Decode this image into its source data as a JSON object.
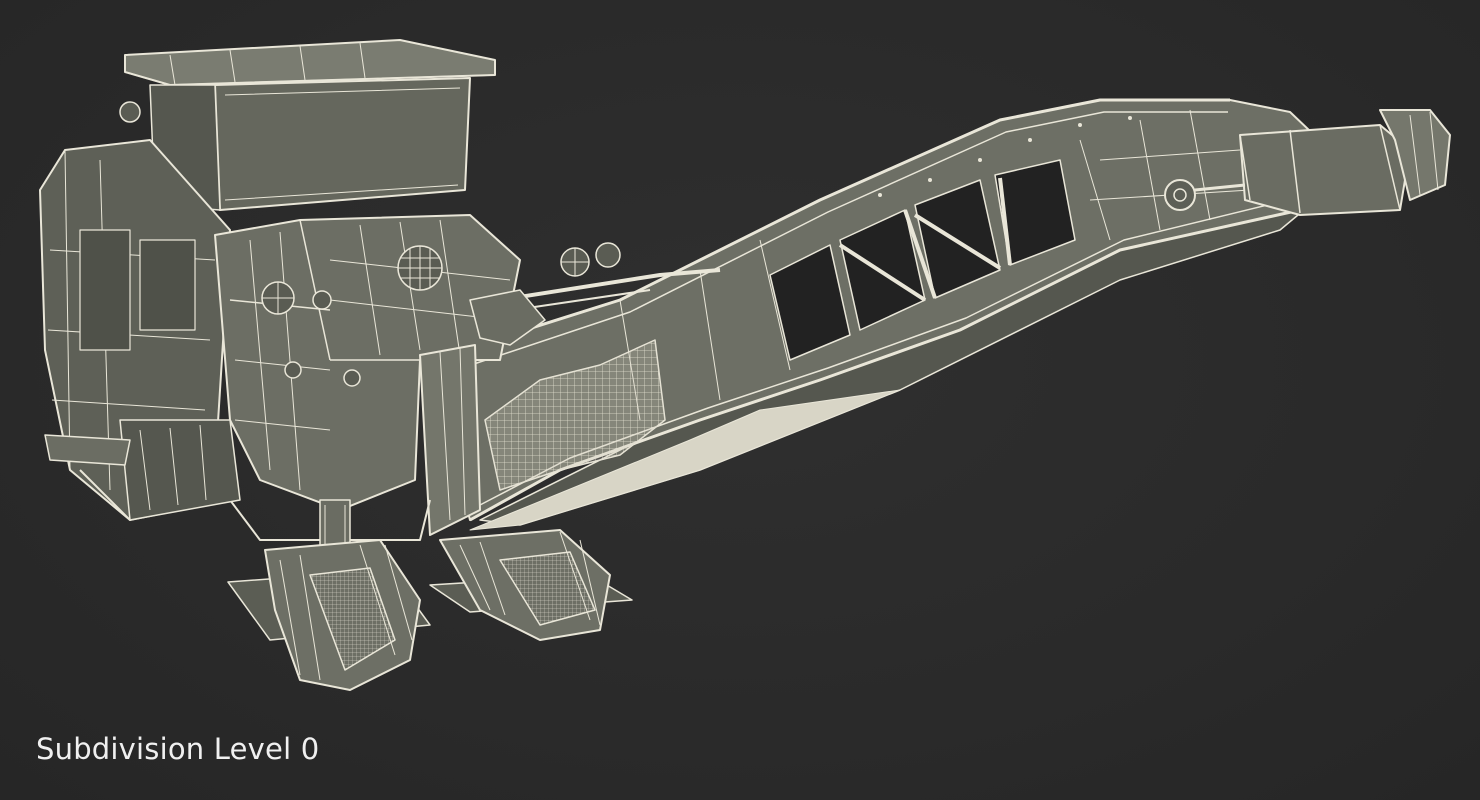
{
  "caption": {
    "text": "Subdivision Level 0"
  },
  "palette": {
    "background": "#2b2b2b",
    "wire": "#e9e6d8",
    "surface": "#6f7166",
    "shadow": "#4b4c45",
    "caption": "#f0f0f0"
  }
}
